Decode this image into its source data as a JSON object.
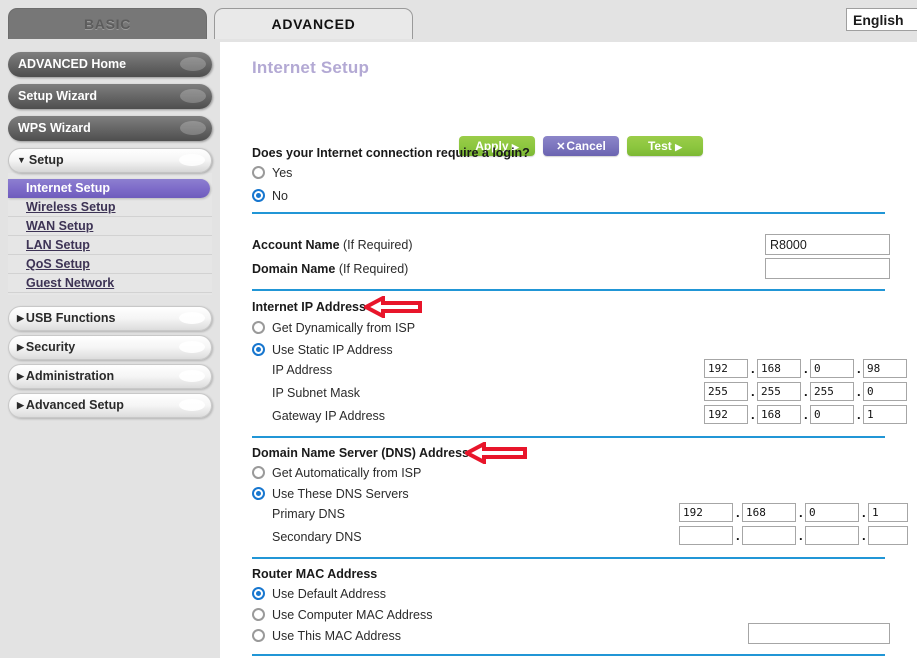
{
  "tabs": [
    {
      "label": "BASIC",
      "active": false
    },
    {
      "label": "ADVANCED",
      "active": true
    }
  ],
  "language": {
    "selected": "English"
  },
  "sidebar": {
    "buttons": [
      {
        "label": "ADVANCED Home"
      },
      {
        "label": "Setup Wizard"
      },
      {
        "label": "WPS Wizard"
      }
    ],
    "setup_group": {
      "label": "Setup",
      "caret": "▼",
      "items": [
        {
          "label": "Internet Setup",
          "active": true
        },
        {
          "label": "Wireless Setup",
          "active": false
        },
        {
          "label": "WAN Setup",
          "active": false
        },
        {
          "label": "LAN Setup",
          "active": false
        },
        {
          "label": "QoS Setup",
          "active": false
        },
        {
          "label": "Guest Network",
          "active": false
        }
      ]
    },
    "collapsed_groups": [
      {
        "label": "USB Functions",
        "caret": "▶"
      },
      {
        "label": "Security",
        "caret": "▶"
      },
      {
        "label": "Administration",
        "caret": "▶"
      },
      {
        "label": "Advanced Setup",
        "caret": "▶"
      }
    ]
  },
  "main": {
    "title": "Internet Setup",
    "buttons": {
      "apply": "Apply",
      "apply_arrow": "▶",
      "cancel": "Cancel",
      "cancel_icon": "✕",
      "test": "Test",
      "test_arrow": "▶"
    },
    "login_question": {
      "label": "Does your Internet connection require a login?",
      "options": [
        {
          "label": "Yes",
          "selected": false
        },
        {
          "label": "No",
          "selected": true
        }
      ]
    },
    "account": {
      "account_name_label": "Account Name",
      "account_name_hint": "(If Required)",
      "account_name_value": "R8000",
      "domain_name_label": "Domain Name",
      "domain_name_hint": "(If Required)",
      "domain_name_value": ""
    },
    "internet_ip": {
      "heading": "Internet IP Address",
      "annotation": "left-arrow",
      "options": [
        {
          "label": "Get Dynamically from ISP",
          "selected": false
        },
        {
          "label": "Use Static IP Address",
          "selected": true
        }
      ],
      "fields": [
        {
          "label": "IP Address",
          "octets": [
            "192",
            "168",
            "0",
            "98"
          ]
        },
        {
          "label": "IP Subnet Mask",
          "octets": [
            "255",
            "255",
            "255",
            "0"
          ]
        },
        {
          "label": "Gateway IP Address",
          "octets": [
            "192",
            "168",
            "0",
            "1"
          ]
        }
      ]
    },
    "dns": {
      "heading": "Domain Name Server (DNS) Address",
      "annotation": "left-arrow",
      "options": [
        {
          "label": "Get Automatically from ISP",
          "selected": false
        },
        {
          "label": "Use These DNS Servers",
          "selected": true
        }
      ],
      "fields": [
        {
          "label": "Primary DNS",
          "octets": [
            "192",
            "168",
            "0",
            "1"
          ]
        },
        {
          "label": "Secondary DNS",
          "octets": [
            "",
            "",
            "",
            ""
          ]
        }
      ]
    },
    "mac": {
      "heading": "Router MAC Address",
      "options": [
        {
          "label": "Use Default Address",
          "selected": true
        },
        {
          "label": "Use Computer MAC Address",
          "selected": false
        },
        {
          "label": "Use This MAC Address",
          "selected": false
        }
      ],
      "mac_value": ""
    }
  },
  "colors": {
    "accent_blue": "#2196d6",
    "title_purple": "#b3a9d4",
    "active_menu": "#7e6cc9",
    "apply_green": "#8cc63f",
    "cancel_purple": "#7b74bd",
    "annotation_red": "#e8152a"
  }
}
